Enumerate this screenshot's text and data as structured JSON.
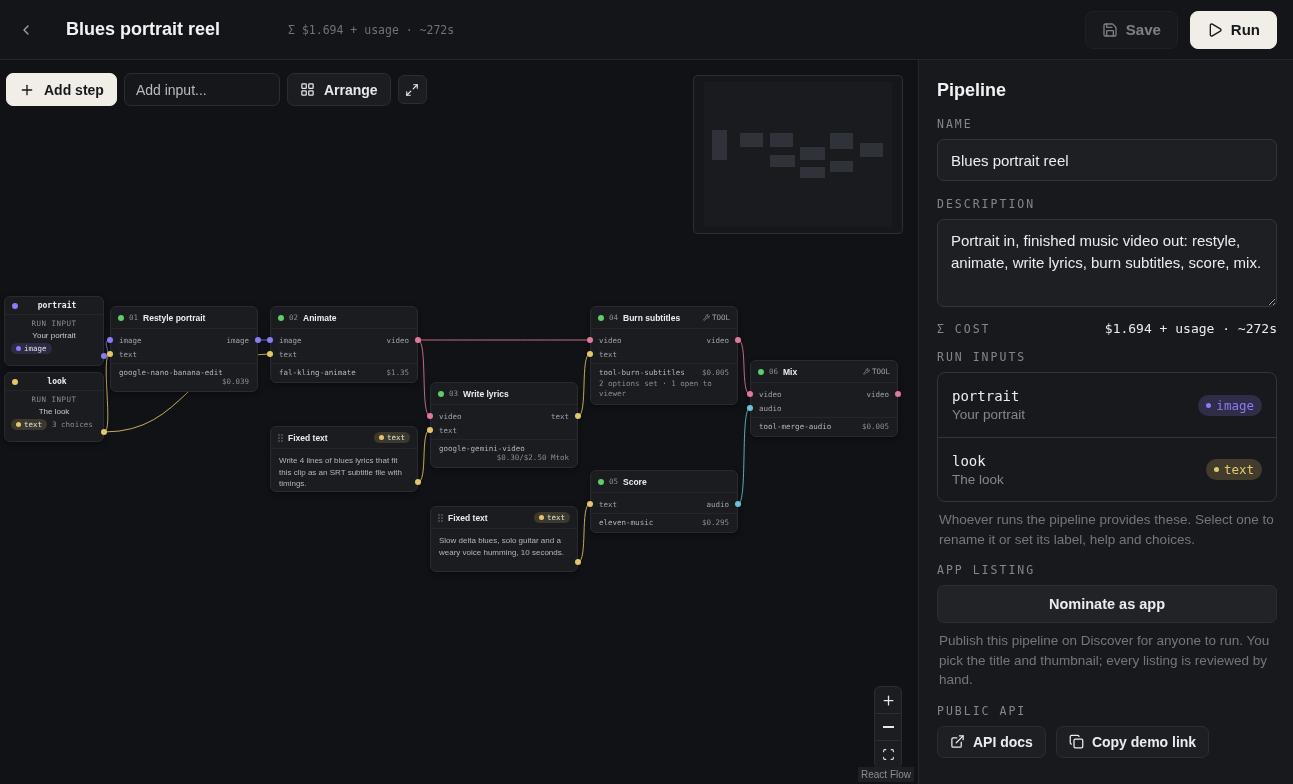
{
  "topbar": {
    "title": "Blues portrait reel",
    "summary": "Σ $1.694 + usage · ~272s",
    "buttons": [
      {
        "label": "Save",
        "kind": "save",
        "disabled": true
      },
      {
        "label": "Run",
        "kind": "run",
        "disabled": false
      }
    ]
  },
  "toolbar": {
    "add_step": "Add step",
    "add_input": {
      "placeholder": "Add input..."
    },
    "arrange": "Arrange"
  },
  "nodes": [
    {
      "kind": "input",
      "name": "portrait",
      "label": "RUN INPUT",
      "description": "Your portrait",
      "type": "image",
      "color": "#8b7cf6"
    },
    {
      "kind": "input",
      "name": "look",
      "label": "RUN INPUT",
      "description": "The look",
      "type": "text",
      "color": "#e5c76b",
      "choices": "3 choices"
    },
    {
      "kind": "step",
      "number": "01",
      "title": "Restyle portrait",
      "inputs": [
        {
          "label": "image",
          "color": "#8b7cf6"
        },
        {
          "label": "text",
          "color": "#e5c76b"
        }
      ],
      "outputs": [
        {
          "label": "image",
          "color": "#8b7cf6"
        }
      ],
      "model": "google-nano-banana-edit",
      "cost": "$0.039"
    },
    {
      "kind": "step",
      "number": "02",
      "title": "Animate",
      "inputs": [
        {
          "label": "image",
          "color": "#8b7cf6"
        },
        {
          "label": "text",
          "color": "#e5c76b"
        }
      ],
      "outputs": [
        {
          "label": "video",
          "color": "#e07a9a"
        }
      ],
      "model": "fal-kling-animate",
      "cost": "$1.35"
    },
    {
      "kind": "fixed",
      "title": "Fixed text",
      "type": "text",
      "color": "#e5c76b",
      "text": "Write 4 lines of blues lyrics that fit this clip as an SRT subtitle file with timings."
    },
    {
      "kind": "step",
      "number": "03",
      "title": "Write lyrics",
      "inputs": [
        {
          "label": "video",
          "color": "#e07a9a"
        },
        {
          "label": "text",
          "color": "#e5c76b"
        }
      ],
      "outputs": [
        {
          "label": "text",
          "color": "#e5c76b"
        }
      ],
      "model": "google-gemini-video",
      "cost": "$0.30/$2.50 Mtok"
    },
    {
      "kind": "fixed",
      "title": "Fixed text",
      "type": "text",
      "color": "#e5c76b",
      "text": "Slow delta blues, solo guitar and a weary voice humming, 10 seconds."
    },
    {
      "kind": "step",
      "number": "04",
      "title": "Burn subtitles",
      "badge": "TOOL",
      "inputs": [
        {
          "label": "video",
          "color": "#e07a9a"
        },
        {
          "label": "text",
          "color": "#e5c76b"
        }
      ],
      "outputs": [
        {
          "label": "video",
          "color": "#e07a9a"
        }
      ],
      "model": "tool-burn-subtitles",
      "cost": "$0.005",
      "note": "2 options set · 1 open to viewer"
    },
    {
      "kind": "step",
      "number": "05",
      "title": "Score",
      "inputs": [
        {
          "label": "text",
          "color": "#e5c76b"
        }
      ],
      "outputs": [
        {
          "label": "audio",
          "color": "#6cc4d8"
        }
      ],
      "model": "eleven-music",
      "cost": "$0.295"
    },
    {
      "kind": "step",
      "number": "06",
      "title": "Mix",
      "badge": "TOOL",
      "inputs": [
        {
          "label": "video",
          "color": "#e07a9a"
        },
        {
          "label": "audio",
          "color": "#6cc4d8"
        }
      ],
      "outputs": [
        {
          "label": "video",
          "color": "#e07a9a"
        }
      ],
      "model": "tool-merge-audio",
      "cost": "$0.005"
    }
  ],
  "attribution": "React Flow",
  "panel": {
    "title": "Pipeline",
    "name_label": "NAME",
    "name": {
      "value": "Blues portrait reel"
    },
    "description_label": "DESCRIPTION",
    "description": {
      "value": "Portrait in, finished music video out: restyle, animate, write lyrics, burn subtitles, score, mix."
    },
    "cost_label": "Σ COST",
    "cost": "$1.694 + usage · ~272s",
    "run_inputs_label": "RUN INPUTS",
    "run_inputs": [
      {
        "name": "portrait",
        "description": "Your portrait",
        "type": "image",
        "color": "#8b7cf6"
      },
      {
        "name": "look",
        "description": "The look",
        "type": "text",
        "color": "#e5c76b"
      }
    ],
    "run_inputs_help": "Whoever runs the pipeline provides these. Select one to rename it or set its label, help and choices.",
    "app_listing_label": "APP LISTING",
    "nominate_button": "Nominate as app",
    "app_listing_help": "Publish this pipeline on Discover for anyone to run. You pick the title and thumbnail; every listing is reviewed by hand.",
    "public_api_label": "PUBLIC API",
    "api_buttons": [
      {
        "label": "API docs",
        "kind": "docs"
      },
      {
        "label": "Copy demo link",
        "kind": "copy"
      }
    ]
  }
}
